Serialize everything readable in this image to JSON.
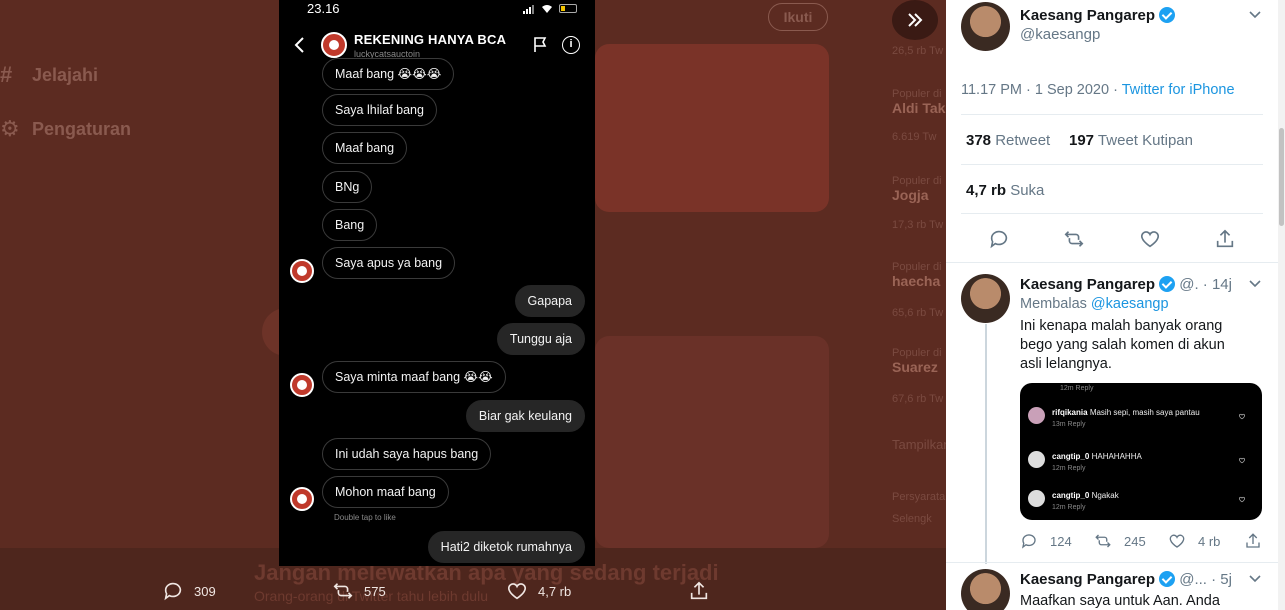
{
  "background": {
    "nav": [
      {
        "label": "Jelajahi",
        "icon": "hash-icon"
      },
      {
        "label": "Pengaturan",
        "icon": "gear-icon"
      }
    ],
    "follow_label": "Ikuti",
    "trends": [
      {
        "meta": "26,5 rb Tw",
        "title": ""
      },
      {
        "meta": "Populer di",
        "title": "Aldi Tak"
      },
      {
        "meta": "6.619 Tw",
        "title": ""
      },
      {
        "meta": "Populer di",
        "title": "Jogja"
      },
      {
        "meta": "17,3 rb Tw",
        "title": ""
      },
      {
        "meta": "Populer di",
        "title": "haecha"
      },
      {
        "meta": "65,6 rb Tw",
        "title": ""
      },
      {
        "meta": "Populer di",
        "title": "Suarez"
      },
      {
        "meta": "67,6 rb Tw",
        "title": ""
      },
      {
        "meta": "Tampilkan",
        "title": ""
      },
      {
        "meta": "Persyarata",
        "title": ""
      },
      {
        "meta": "Selengk",
        "title": ""
      }
    ],
    "banner_title": "Jangan melewatkan apa yang sedang terjadi",
    "banner_sub": "Orang-orang di Twitter tahu lebih dulu",
    "actions": {
      "replies": "309",
      "retweets": "575",
      "likes": "4,7 rb"
    }
  },
  "phone": {
    "time": "23.16",
    "account_name": "REKENING HANYA BCA",
    "account_user": "luckycatsauctoin",
    "messages": [
      {
        "text": "Maaf bang 😭😭😭",
        "me": false
      },
      {
        "text": "Saya lhilaf bang",
        "me": false
      },
      {
        "text": "Maaf bang",
        "me": false
      },
      {
        "text": "BNg",
        "me": false
      },
      {
        "text": "Bang",
        "me": false
      },
      {
        "text": "Saya apus ya bang",
        "me": false
      },
      {
        "text": "Gapapa",
        "me": true
      },
      {
        "text": "Tunggu aja",
        "me": true
      },
      {
        "text": "Saya minta maaf bang 😭😭",
        "me": false
      },
      {
        "text": "Biar gak keulang",
        "me": true
      },
      {
        "text": "Ini udah saya hapus bang",
        "me": false
      },
      {
        "text": "Mohon maaf bang",
        "me": false
      },
      {
        "text": "Hati2 diketok rumahnya",
        "me": true
      }
    ],
    "double_tap": "Double tap to like"
  },
  "tweet": {
    "name": "Kaesang Pangarep",
    "handle": "@kaesangp",
    "timestamp": "11.17 PM · 1 Sep 2020 · ",
    "source": "Twitter for iPhone",
    "retweet_count": "378",
    "retweet_label": " Retweet",
    "quote_count": "197",
    "quote_label": " Tweet Kutipan",
    "like_count": "4,7 rb",
    "like_label": " Suka"
  },
  "replies": [
    {
      "name": "Kaesang Pangarep",
      "handle_time": "@. · 14j",
      "replying_prefix": "Membalas ",
      "replying_to": "@kaesangp",
      "text": "Ini kenapa malah banyak orang bego yang salah komen di akun asli lelangnya.",
      "embed": {
        "top": "12m   Reply",
        "rows": [
          {
            "user": "rifqikania",
            "comment": "Masih sepi, masih saya pantau",
            "meta": "13m   Reply"
          },
          {
            "user": "cangtip_0",
            "comment": "HAHAHAHHA",
            "meta": "12m   Reply"
          },
          {
            "user": "cangtip_0",
            "comment": "Ngakak",
            "meta": "12m   Reply"
          }
        ]
      },
      "counts": {
        "replies": "124",
        "retweets": "245",
        "likes": "4 rb"
      }
    },
    {
      "name": "Kaesang Pangarep",
      "handle_time": "@... · 5j",
      "text": "Maafkan saya untuk Aan. Anda"
    }
  ],
  "colors": {
    "accent": "#1da1f2",
    "link": "#1b95e0",
    "overlay": "#5c2b21"
  }
}
